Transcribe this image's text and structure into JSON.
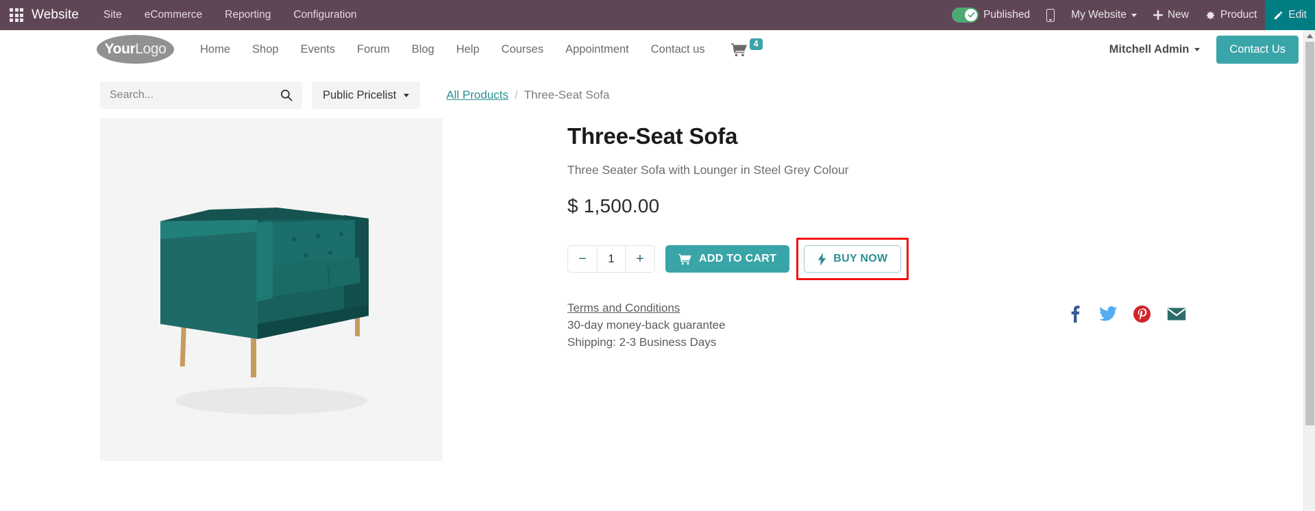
{
  "odoo_bar": {
    "apps_icon": "apps-grid-icon",
    "app_name": "Website",
    "menus": [
      {
        "label": "Site"
      },
      {
        "label": "eCommerce"
      },
      {
        "label": "Reporting"
      },
      {
        "label": "Configuration"
      }
    ],
    "published_label": "Published",
    "published_state": "on",
    "mobile_icon": "mobile-preview-icon",
    "website_selector": "My Website",
    "new_label": "New",
    "product_label": "Product",
    "edit_label": "Edit",
    "colors": {
      "bar_background": "#5f4656",
      "edit_button": "#017e84",
      "toggle_on": "#4ea972"
    }
  },
  "site_header": {
    "logo_primary": "Your",
    "logo_secondary": "Logo",
    "nav": [
      {
        "label": "Home"
      },
      {
        "label": "Shop"
      },
      {
        "label": "Events"
      },
      {
        "label": "Forum"
      },
      {
        "label": "Blog"
      },
      {
        "label": "Help"
      },
      {
        "label": "Courses"
      },
      {
        "label": "Appointment"
      },
      {
        "label": "Contact us"
      }
    ],
    "cart_count": "4",
    "user_name": "Mitchell Admin",
    "contact_button": "Contact Us",
    "accent_color": "#3aa5a8"
  },
  "tools": {
    "search_placeholder": "Search...",
    "search_value": "",
    "search_icon": "search-icon",
    "pricelist_label": "Public Pricelist",
    "breadcrumb": {
      "parent": "All Products",
      "separator": "/",
      "current": "Three-Seat Sofa"
    }
  },
  "product": {
    "image_alt": "Three-Seat Sofa in dark teal fabric with wooden legs",
    "title": "Three-Seat Sofa",
    "subtitle": "Three Seater Sofa with Lounger in Steel Grey Colour",
    "currency": "$",
    "price": "1,500.00",
    "quantity": "1",
    "decrease_label": "−",
    "increase_label": "+",
    "add_to_cart_label": "ADD TO CART",
    "buy_now_label": "BUY NOW",
    "buy_now_highlighted": true,
    "highlight_color": "#f40f0f",
    "terms_link": "Terms and Conditions",
    "guarantee": "30-day money-back guarantee",
    "shipping": "Shipping: 2-3 Business Days",
    "socials": [
      {
        "name": "facebook-icon",
        "color": "#3b5998"
      },
      {
        "name": "twitter-icon",
        "color": "#55acee"
      },
      {
        "name": "pinterest-icon",
        "color": "#d3232b"
      },
      {
        "name": "email-icon",
        "color": "#2e6b6b"
      }
    ]
  },
  "scrollbar": {
    "up_arrow_icon": "scroll-up-arrow-icon"
  }
}
